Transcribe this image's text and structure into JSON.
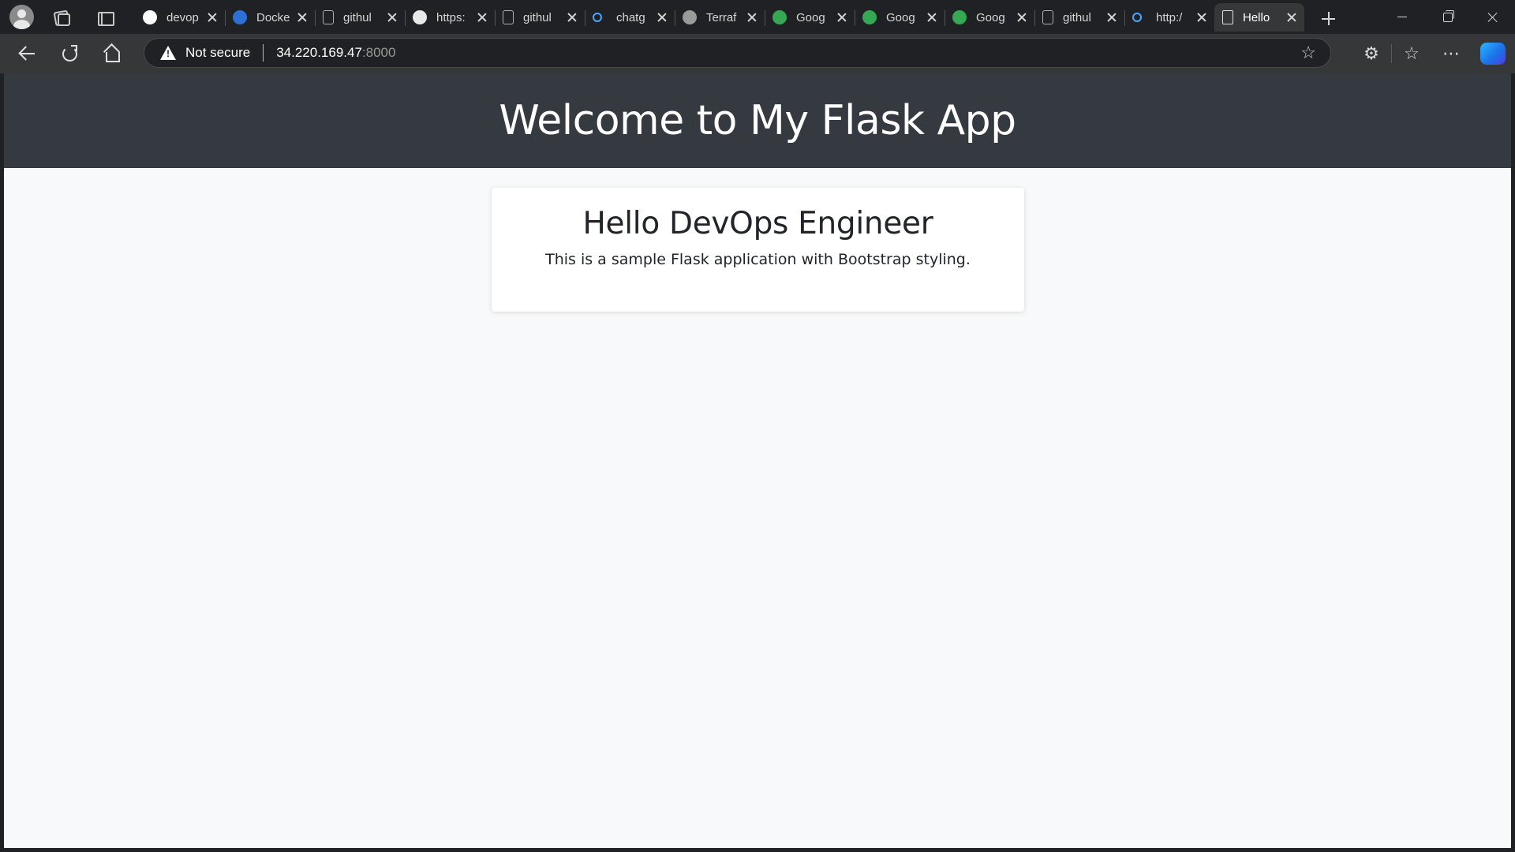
{
  "browser": {
    "tabs": [
      {
        "title": "devop",
        "icon": "github-icon",
        "color": "#ffffff",
        "active": false
      },
      {
        "title": "Docke",
        "icon": "docker-icon",
        "color": "#2e6fd6",
        "active": false
      },
      {
        "title": "githul",
        "icon": "page-icon",
        "color": "#b0b0b0",
        "active": false
      },
      {
        "title": "https:",
        "icon": "google-icon",
        "color": "#e8e8e8",
        "active": false
      },
      {
        "title": "githul",
        "icon": "page-icon",
        "color": "#b0b0b0",
        "active": false
      },
      {
        "title": "chatg",
        "icon": "search-icon",
        "color": "#4aa8ff",
        "active": false
      },
      {
        "title": "Terraf",
        "icon": "openai-icon",
        "color": "#9a9a9a",
        "active": false
      },
      {
        "title": "Goog",
        "icon": "google-cloud-icon",
        "color": "#34a853",
        "active": false
      },
      {
        "title": "Goog",
        "icon": "google-cloud-icon",
        "color": "#34a853",
        "active": false
      },
      {
        "title": "Goog",
        "icon": "google-cloud-icon",
        "color": "#34a853",
        "active": false
      },
      {
        "title": "githul",
        "icon": "page-icon",
        "color": "#b0b0b0",
        "active": false
      },
      {
        "title": "http:/",
        "icon": "search-icon",
        "color": "#4aa8ff",
        "active": false
      },
      {
        "title": "Hello",
        "icon": "document-icon",
        "color": "#e0e0e0",
        "active": true
      }
    ],
    "address": {
      "security_label": "Not secure",
      "host": "34.220.169.47",
      "port": ":8000"
    }
  },
  "page": {
    "header_title": "Welcome to My Flask App",
    "card_title": "Hello DevOps Engineer",
    "card_text": "This is a sample Flask application with Bootstrap styling."
  },
  "colors": {
    "header_bg": "#343a40",
    "body_bg": "#f8f9fa",
    "card_bg": "#ffffff"
  }
}
